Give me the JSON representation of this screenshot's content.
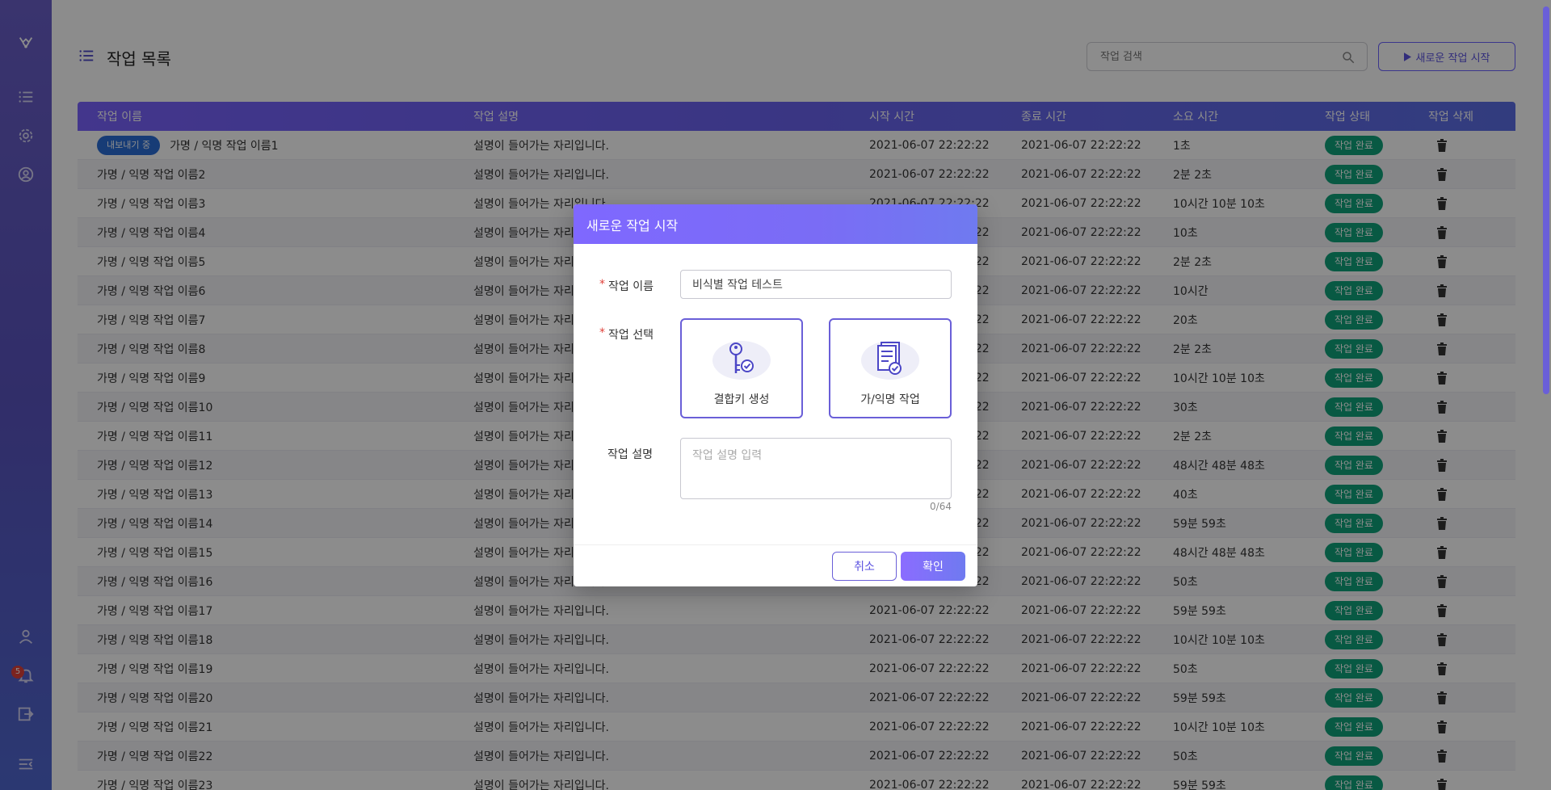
{
  "sidebar": {
    "notification_count": "5",
    "icons": [
      "logo-icon",
      "list-icon",
      "settings-icon",
      "user-circle-icon",
      "person-icon",
      "bell-icon",
      "logout-icon",
      "collapse-menu-icon"
    ]
  },
  "header": {
    "title": "작업 목록",
    "search_placeholder": "작업 검색",
    "new_task_label": "새로운 작업 시작"
  },
  "table": {
    "columns": [
      "작업 이름",
      "작업 설명",
      "시작 시간",
      "종료 시간",
      "소요 시간",
      "작업 상태",
      "작업 삭제"
    ],
    "export_badge": "내보내기 중",
    "rows": [
      {
        "name": "가명 / 익명 작업 이름1",
        "desc": "설명이 들어가는 자리입니다.",
        "start": "2021-06-07 22:22:22",
        "end": "2021-06-07 22:22:22",
        "duration": "1초",
        "status": "작업 완료"
      },
      {
        "name": "가명 / 익명 작업 이름2",
        "desc": "설명이 들어가는 자리입니다.",
        "start": "2021-06-07 22:22:22",
        "end": "2021-06-07 22:22:22",
        "duration": "2분 2초",
        "status": "작업 완료"
      },
      {
        "name": "가명 / 익명 작업 이름3",
        "desc": "설명이 들어가는 자리입니다.",
        "start": "2021-06-07 22:22:22",
        "end": "2021-06-07 22:22:22",
        "duration": "10시간 10분 10초",
        "status": "작업 완료"
      },
      {
        "name": "가명 / 익명 작업 이름4",
        "desc": "설명이 들어가는 자리입니다.",
        "start": "2021-06-07 22:22:22",
        "end": "2021-06-07 22:22:22",
        "duration": "10초",
        "status": "작업 완료"
      },
      {
        "name": "가명 / 익명 작업 이름5",
        "desc": "설명이 들어가는 자리입니다.",
        "start": "2021-06-07 22:22:22",
        "end": "2021-06-07 22:22:22",
        "duration": "2분 2초",
        "status": "작업 완료"
      },
      {
        "name": "가명 / 익명 작업 이름6",
        "desc": "설명이 들어가는 자리입니다.",
        "start": "2021-06-07 22:22:22",
        "end": "2021-06-07 22:22:22",
        "duration": "10시간",
        "status": "작업 완료"
      },
      {
        "name": "가명 / 익명 작업 이름7",
        "desc": "설명이 들어가는 자리입니다.",
        "start": "2021-06-07 22:22:22",
        "end": "2021-06-07 22:22:22",
        "duration": "20초",
        "status": "작업 완료"
      },
      {
        "name": "가명 / 익명 작업 이름8",
        "desc": "설명이 들어가는 자리입니다.",
        "start": "2021-06-07 22:22:22",
        "end": "2021-06-07 22:22:22",
        "duration": "2분 2초",
        "status": "작업 완료"
      },
      {
        "name": "가명 / 익명 작업 이름9",
        "desc": "설명이 들어가는 자리입니다.",
        "start": "2021-06-07 22:22:22",
        "end": "2021-06-07 22:22:22",
        "duration": "10시간 10분 10초",
        "status": "작업 완료"
      },
      {
        "name": "가명 / 익명 작업 이름10",
        "desc": "설명이 들어가는 자리입니다.",
        "start": "2021-06-07 22:22:22",
        "end": "2021-06-07 22:22:22",
        "duration": "30초",
        "status": "작업 완료"
      },
      {
        "name": "가명 / 익명 작업 이름11",
        "desc": "설명이 들어가는 자리입니다.",
        "start": "2021-06-07 22:22:22",
        "end": "2021-06-07 22:22:22",
        "duration": "2분 2초",
        "status": "작업 완료"
      },
      {
        "name": "가명 / 익명 작업 이름12",
        "desc": "설명이 들어가는 자리입니다.",
        "start": "2021-06-07 22:22:22",
        "end": "2021-06-07 22:22:22",
        "duration": "48시간 48분 48초",
        "status": "작업 완료"
      },
      {
        "name": "가명 / 익명 작업 이름13",
        "desc": "설명이 들어가는 자리입니다.",
        "start": "2021-06-07 22:22:22",
        "end": "2021-06-07 22:22:22",
        "duration": "40초",
        "status": "작업 완료"
      },
      {
        "name": "가명 / 익명 작업 이름14",
        "desc": "설명이 들어가는 자리입니다.",
        "start": "2021-06-07 22:22:22",
        "end": "2021-06-07 22:22:22",
        "duration": "59분 59초",
        "status": "작업 완료"
      },
      {
        "name": "가명 / 익명 작업 이름15",
        "desc": "설명이 들어가는 자리입니다.",
        "start": "2021-06-07 22:22:22",
        "end": "2021-06-07 22:22:22",
        "duration": "48시간 48분 48초",
        "status": "작업 완료"
      },
      {
        "name": "가명 / 익명 작업 이름16",
        "desc": "설명이 들어가는 자리입니다.",
        "start": "2021-06-07 22:22:22",
        "end": "2021-06-07 22:22:22",
        "duration": "50초",
        "status": "작업 완료"
      },
      {
        "name": "가명 / 익명 작업 이름17",
        "desc": "설명이 들어가는 자리입니다.",
        "start": "2021-06-07 22:22:22",
        "end": "2021-06-07 22:22:22",
        "duration": "59분 59초",
        "status": "작업 완료"
      },
      {
        "name": "가명 / 익명 작업 이름18",
        "desc": "설명이 들어가는 자리입니다.",
        "start": "2021-06-07 22:22:22",
        "end": "2021-06-07 22:22:22",
        "duration": "10시간 10분 10초",
        "status": "작업 완료"
      },
      {
        "name": "가명 / 익명 작업 이름19",
        "desc": "설명이 들어가는 자리입니다.",
        "start": "2021-06-07 22:22:22",
        "end": "2021-06-07 22:22:22",
        "duration": "50초",
        "status": "작업 완료"
      },
      {
        "name": "가명 / 익명 작업 이름20",
        "desc": "설명이 들어가는 자리입니다.",
        "start": "2021-06-07 22:22:22",
        "end": "2021-06-07 22:22:22",
        "duration": "59분 59초",
        "status": "작업 완료"
      },
      {
        "name": "가명 / 익명 작업 이름21",
        "desc": "설명이 들어가는 자리입니다.",
        "start": "2021-06-07 22:22:22",
        "end": "2021-06-07 22:22:22",
        "duration": "10시간 10분 10초",
        "status": "작업 완료"
      },
      {
        "name": "가명 / 익명 작업 이름22",
        "desc": "설명이 들어가는 자리입니다.",
        "start": "2021-06-07 22:22:22",
        "end": "2021-06-07 22:22:22",
        "duration": "50초",
        "status": "작업 완료"
      },
      {
        "name": "가명 / 익명 작업 이름23",
        "desc": "설명이 들어가는 자리입니다.",
        "start": "2021-06-07 22:22:22",
        "end": "2021-06-07 22:22:22",
        "duration": "59분 59초",
        "status": "작업 완료"
      }
    ]
  },
  "modal": {
    "title": "새로운 작업 시작",
    "name_label": "작업 이름",
    "name_value": "비식별 작업 테스트",
    "type_label": "작업 선택",
    "choices": [
      {
        "label": "결합키 생성",
        "icon": "key-check-icon"
      },
      {
        "label": "가/익명 작업",
        "icon": "document-check-icon"
      }
    ],
    "desc_label": "작업 설명",
    "desc_placeholder": "작업 설명 입력",
    "counter": "0/64",
    "cancel_label": "취소",
    "ok_label": "확인"
  },
  "colors": {
    "accent": "#6a5fd8",
    "status_green": "#0fa37a",
    "export_blue": "#2a6dd8",
    "required_red": "#e0413a"
  }
}
